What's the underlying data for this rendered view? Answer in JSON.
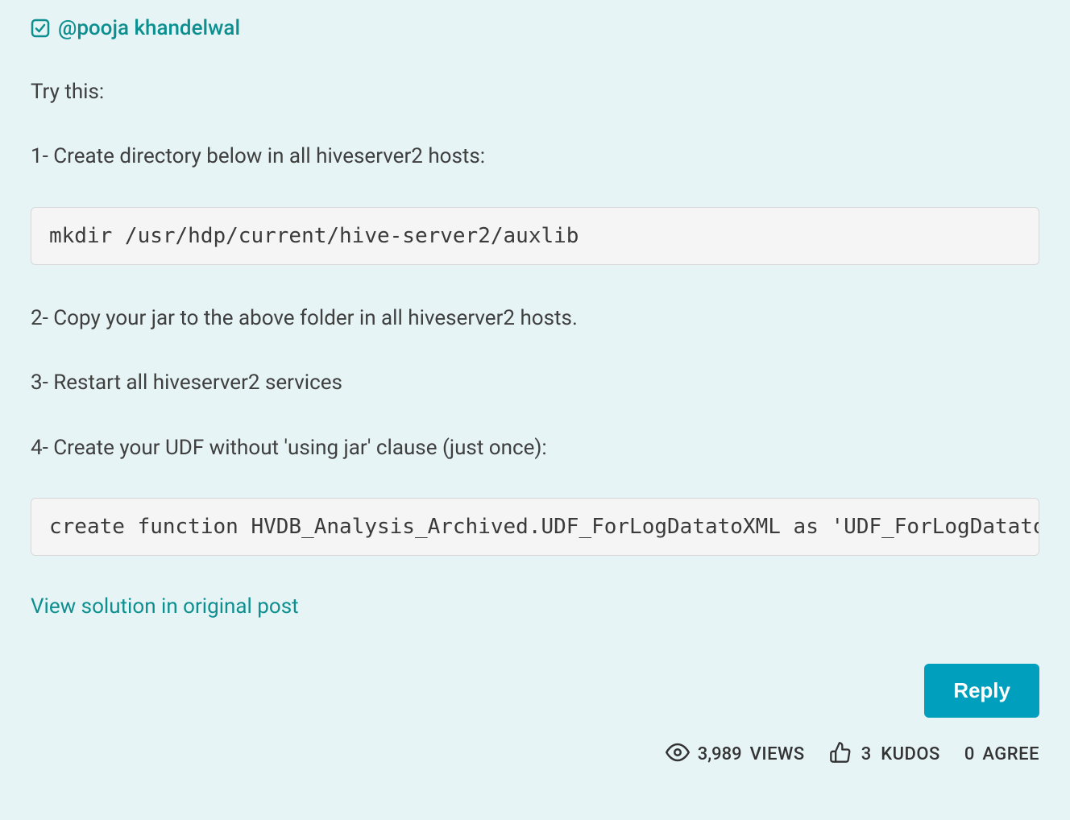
{
  "mention": "@pooja khandelwal",
  "content": {
    "intro": "Try this:",
    "step1": "1- Create directory below in all hiveserver2 hosts:",
    "code1": "mkdir /usr/hdp/current/hive-server2/auxlib",
    "step2": "2- Copy your jar to the above folder in all hiveserver2 hosts.",
    "step3": "3- Restart all hiveserver2 services",
    "step4": "4- Create your UDF without 'using jar' clause (just once):",
    "code2": "create function HVDB_Analysis_Archived.UDF_ForLogDatatoXML as 'UDF_ForLogDatatoXML';"
  },
  "links": {
    "view_solution": "View solution in original post"
  },
  "actions": {
    "reply": "Reply"
  },
  "stats": {
    "views_count": "3,989",
    "views_label": "VIEWS",
    "kudos_count": "3",
    "kudos_label": "KUDOS",
    "agree_count": "0",
    "agree_label": "AGREE"
  }
}
